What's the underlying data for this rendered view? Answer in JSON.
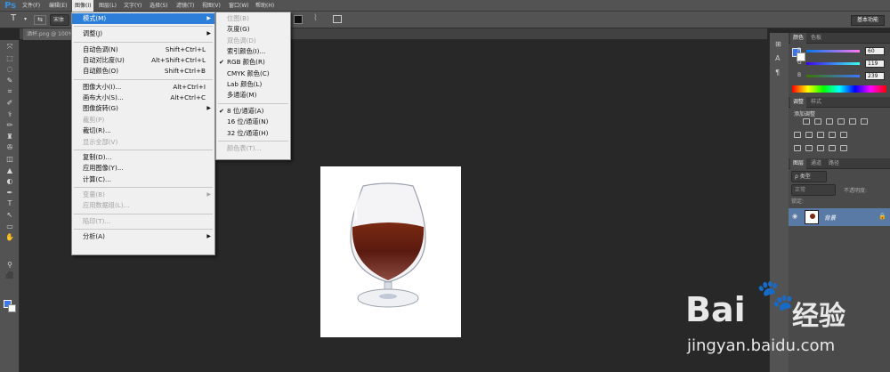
{
  "app": {
    "logo": "Ps"
  },
  "menubar": [
    "文件(F)",
    "编辑(E)",
    "图像(I)",
    "图层(L)",
    "文字(Y)",
    "选择(S)",
    "滤镜(T)",
    "视图(V)",
    "窗口(W)",
    "帮助(H)"
  ],
  "menubar_active_index": 2,
  "options_bar": {
    "tool_glyph": "T",
    "font_family": "宋体",
    "workspace_button": "基本功能"
  },
  "document": {
    "tab_label": "酒杯.png @ 100%"
  },
  "image_menu": {
    "items": [
      {
        "label": "模式(M)",
        "shortcut": "",
        "submenu": true,
        "disabled": false,
        "highlighted": true
      },
      {
        "sep": true
      },
      {
        "label": "调整(J)",
        "shortcut": "",
        "submenu": true,
        "disabled": false
      },
      {
        "sep": true
      },
      {
        "label": "自动色调(N)",
        "shortcut": "Shift+Ctrl+L",
        "disabled": false
      },
      {
        "label": "自动对比度(U)",
        "shortcut": "Alt+Shift+Ctrl+L",
        "disabled": false
      },
      {
        "label": "自动颜色(O)",
        "shortcut": "Shift+Ctrl+B",
        "disabled": false
      },
      {
        "sep": true
      },
      {
        "label": "图像大小(I)...",
        "shortcut": "Alt+Ctrl+I",
        "disabled": false
      },
      {
        "label": "画布大小(S)...",
        "shortcut": "Alt+Ctrl+C",
        "disabled": false
      },
      {
        "label": "图像旋转(G)",
        "shortcut": "",
        "submenu": true,
        "disabled": false
      },
      {
        "label": "裁剪(P)",
        "shortcut": "",
        "disabled": true
      },
      {
        "label": "裁切(R)...",
        "shortcut": "",
        "disabled": false
      },
      {
        "label": "显示全部(V)",
        "shortcut": "",
        "disabled": true
      },
      {
        "sep": true
      },
      {
        "label": "复制(D)...",
        "shortcut": "",
        "disabled": false
      },
      {
        "label": "应用图像(Y)...",
        "shortcut": "",
        "disabled": false
      },
      {
        "label": "计算(C)...",
        "shortcut": "",
        "disabled": false
      },
      {
        "sep": true
      },
      {
        "label": "变量(B)",
        "shortcut": "",
        "submenu": true,
        "disabled": true
      },
      {
        "label": "应用数据组(L)...",
        "shortcut": "",
        "disabled": true
      },
      {
        "sep": true
      },
      {
        "label": "陷印(T)...",
        "shortcut": "",
        "disabled": true
      },
      {
        "sep": true
      },
      {
        "label": "分析(A)",
        "shortcut": "",
        "submenu": true,
        "disabled": false
      }
    ]
  },
  "mode_submenu": {
    "items": [
      {
        "label": "位图(B)",
        "disabled": true,
        "checked": false
      },
      {
        "label": "灰度(G)",
        "disabled": false,
        "checked": false
      },
      {
        "label": "双色调(D)",
        "disabled": true,
        "checked": false
      },
      {
        "label": "索引颜色(I)...",
        "disabled": false,
        "checked": false
      },
      {
        "label": "RGB 颜色(R)",
        "disabled": false,
        "checked": true
      },
      {
        "label": "CMYK 颜色(C)",
        "disabled": false,
        "checked": false
      },
      {
        "label": "Lab 颜色(L)",
        "disabled": false,
        "checked": false
      },
      {
        "label": "多通道(M)",
        "disabled": false,
        "checked": false
      },
      {
        "sep": true
      },
      {
        "label": "8 位/通道(A)",
        "disabled": false,
        "checked": true
      },
      {
        "label": "16 位/通道(N)",
        "disabled": false,
        "checked": false
      },
      {
        "label": "32 位/通道(H)",
        "disabled": false,
        "checked": false
      },
      {
        "sep": true
      },
      {
        "label": "颜色表(T)...",
        "disabled": true,
        "checked": false
      }
    ]
  },
  "color_panel": {
    "tabs": [
      "颜色",
      "色板"
    ],
    "channels": [
      {
        "label": "R",
        "value": "60"
      },
      {
        "label": "G",
        "value": "119"
      },
      {
        "label": "B",
        "value": "239"
      }
    ],
    "foreground": "#3c77ef"
  },
  "adjust_panel": {
    "tabs": [
      "调整",
      "样式"
    ],
    "title": "添加调整"
  },
  "layers_panel": {
    "tabs": [
      "图层",
      "通道",
      "路径"
    ],
    "filter": "ρ 类型",
    "blend_mode": "正常",
    "opacity_label": "不透明度:",
    "lock_label": "锁定:",
    "layer_name": "背景"
  },
  "watermark": {
    "brand": "Bai",
    "suffix": "经验",
    "url": "jingyan.baidu.com"
  }
}
